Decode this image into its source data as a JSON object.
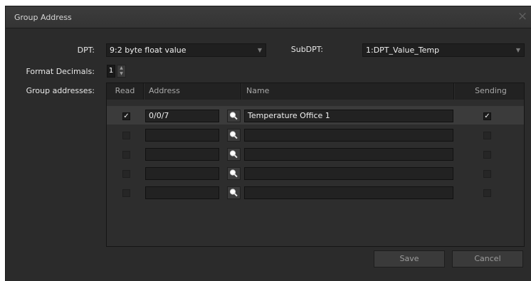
{
  "dialog": {
    "title": "Group Address",
    "close_symbol": "×"
  },
  "form": {
    "dpt_label": "DPT:",
    "dpt_value": "9:2 byte float value",
    "subdpt_label": "SubDPT:",
    "subdpt_value": "1:DPT_Value_Temp",
    "format_decimals_label": "Format Decimals:",
    "format_decimals_value": "1",
    "group_addresses_label": "Group addresses:"
  },
  "table": {
    "columns": [
      "Read",
      "Address",
      "Name",
      "Sending"
    ],
    "rows": [
      {
        "read": true,
        "address": "0/0/7",
        "name": "Temperature Office 1",
        "sending": true
      },
      {
        "read": false,
        "address": "",
        "name": "",
        "sending": false
      },
      {
        "read": false,
        "address": "",
        "name": "",
        "sending": false
      },
      {
        "read": false,
        "address": "",
        "name": "",
        "sending": false
      },
      {
        "read": false,
        "address": "",
        "name": "",
        "sending": false
      }
    ]
  },
  "buttons": {
    "save": "Save",
    "cancel": "Cancel"
  },
  "icons": {
    "search": "magnifier-icon",
    "dropdown": "chevron-down-icon",
    "check": "checkmark-icon"
  }
}
